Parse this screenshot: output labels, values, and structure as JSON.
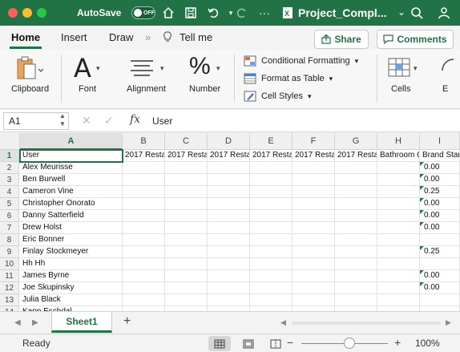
{
  "titlebar": {
    "autosave_label": "AutoSave",
    "autosave_state": "OFF",
    "doc_title": "Project_Compl..."
  },
  "tabs": {
    "home": "Home",
    "insert": "Insert",
    "draw": "Draw",
    "tell_me": "Tell me",
    "share": "Share",
    "comments": "Comments"
  },
  "ribbon": {
    "clipboard": "Clipboard",
    "font": "Font",
    "alignment": "Alignment",
    "number": "Number",
    "conditional_formatting": "Conditional Formatting",
    "format_as_table": "Format as Table",
    "cell_styles": "Cell Styles",
    "cells": "Cells",
    "editing_partial": "E"
  },
  "formula_bar": {
    "name_box": "A1",
    "fx": "fx",
    "value": "User"
  },
  "grid": {
    "columns": [
      "A",
      "B",
      "C",
      "D",
      "E",
      "F",
      "G",
      "H",
      "I"
    ],
    "rows": [
      "1",
      "2",
      "3",
      "4",
      "5",
      "6",
      "7",
      "8",
      "9",
      "10",
      "11",
      "12",
      "13",
      "14"
    ],
    "header_row": [
      "User",
      "2017 Resta",
      "2017 Resta",
      "2017 Resta",
      "2017 Resta",
      "2017 Resta",
      "2017 Resta",
      "Bathroom C",
      "Brand Stan"
    ],
    "users": [
      "Alex Meurisse",
      "Ben Burwell",
      "Cameron Vine",
      "Christopher Onorato",
      "Danny Satterfield",
      "Drew Holst",
      "Eric Bonner",
      "Finlay Stockmeyer",
      "Hh Hh",
      "James Byrne",
      "Joe Skupinsky",
      "Julia Black",
      "Kapp Eschdal"
    ],
    "col_i_values": [
      "0.00",
      "0.00",
      "0.25",
      "0.00",
      "0.00",
      "0.00",
      "",
      "0.25",
      "",
      "0.00",
      "0.00",
      "",
      ""
    ]
  },
  "sheets": {
    "active": "Sheet1",
    "add": "+"
  },
  "status": {
    "ready": "Ready",
    "zoom": "100%"
  }
}
